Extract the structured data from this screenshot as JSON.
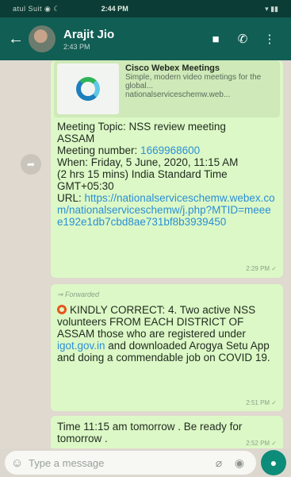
{
  "status_bar": {
    "left": "atul Suit ◉ ☾",
    "time": "2:44 PM",
    "right": "▾ ▮▮"
  },
  "header": {
    "name": "Arajit Jio",
    "status": "2:43 PM"
  },
  "messages": [
    {
      "preview_title": "Cisco Webex Meetings",
      "preview_desc": "Simple, modern video meetings for the global...",
      "preview_domain": "nationalserviceschemw.web...",
      "text_lines": [
        "Meeting Topic: NSS review meeting",
        "ASSAM",
        "Meeting number: ",
        "When: Friday, 5 June, 2020, 11:15 AM",
        "(2 hrs 15 mins) India Standard Time",
        "GMT+05:30",
        "URL: "
      ],
      "meeting_number": "1669968600",
      "url": "https://nationalserviceschemw.webex.com/nationalserviceschemw/j.php?MTID=meeee192e1db7cbd8ae731bf8b3939450",
      "time": "2:29 PM ✓"
    },
    {
      "forwarded": "⇒ Forwarded",
      "text_before": "KINDLY CORRECT: 4. Two active NSS volunteers FROM EACH DISTRICT OF ASSAM those who are registered under ",
      "link": "igot.gov.in",
      "text_after": " and downloaded Arogya Setu App and doing a commendable job on COVID 19.",
      "time": "2:51 PM ✓"
    },
    {
      "text": "Time 11:15 am tomorrow . Be ready for tomorrow .",
      "time": "2:52 PM ✓"
    }
  ],
  "compose": {
    "placeholder": "Type a message"
  }
}
